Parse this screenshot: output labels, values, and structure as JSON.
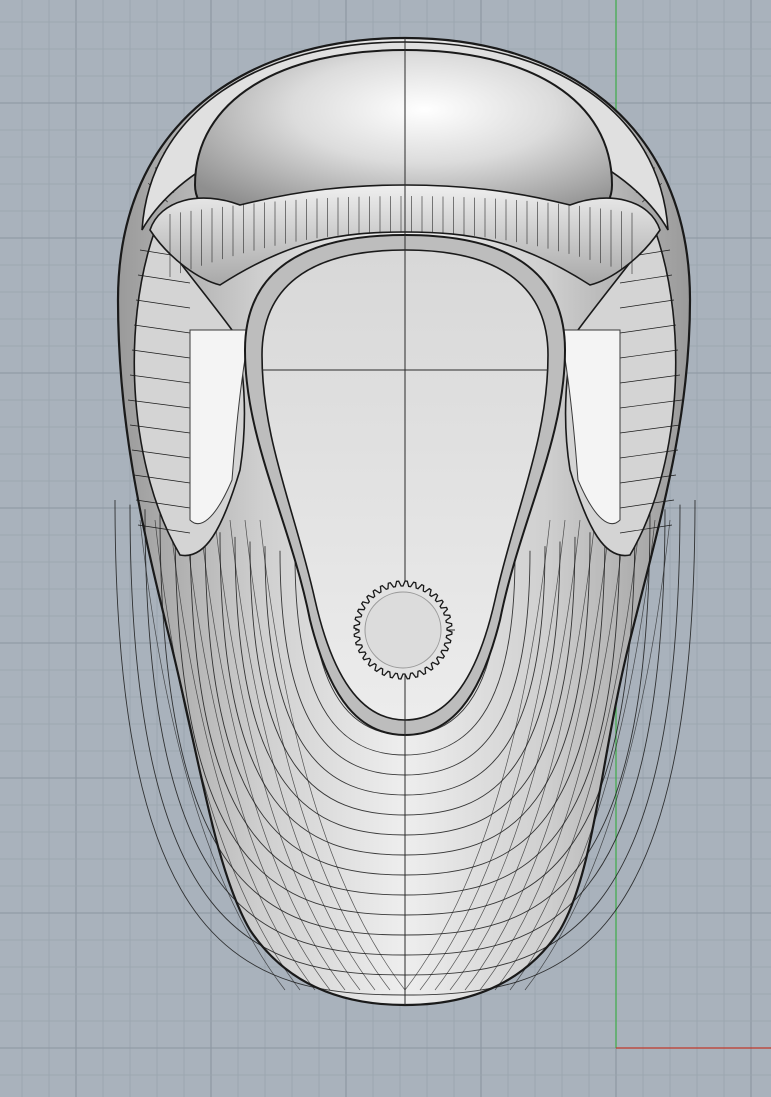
{
  "viewport": {
    "background": "#a9b2bc",
    "grid_minor_color": "#9aa4ae",
    "grid_major_color": "#8c96a1",
    "axis_y_color": "#3fae4a",
    "axis_x_color": "#c0392b",
    "object_stroke": "#1a1a1a",
    "object_fill_light": "#e6e6e6",
    "object_fill_mid": "#c9c9c9",
    "object_fill_dark": "#8a8a8a",
    "highlight": "#ffffff"
  },
  "object": {
    "name": "saddle-shell-model",
    "gear_teeth": 36
  }
}
